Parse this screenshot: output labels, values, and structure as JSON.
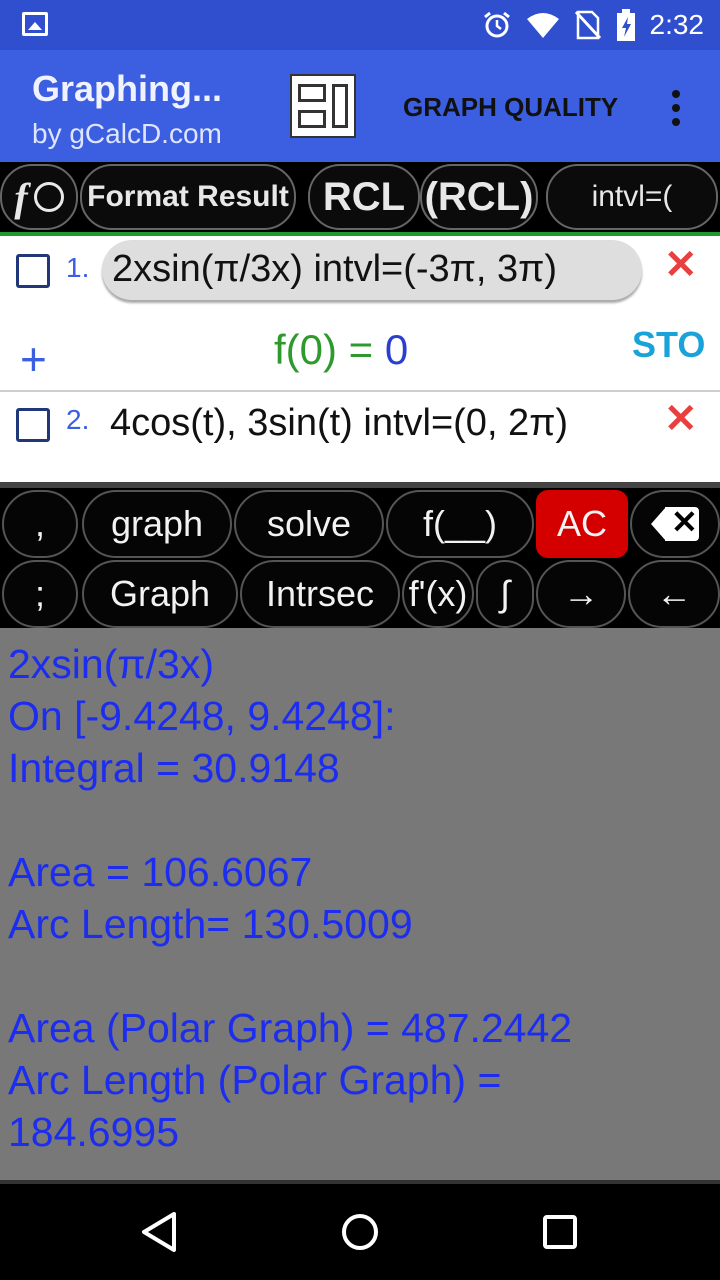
{
  "status_bar": {
    "time": "2:32",
    "icons": [
      "image-icon",
      "alarm-icon",
      "wifi-icon",
      "no-sim-icon",
      "battery-charging-icon"
    ]
  },
  "app_bar": {
    "title": "Graphing...",
    "subtitle": "by gCalcD.com",
    "graph_quality_label": "GRAPH QUALITY"
  },
  "function_toolbar": {
    "f_label": "f",
    "format_result_label": "Format Result",
    "rcl_label": "RCL",
    "paren_rcl_label": "(RCL)",
    "intvl_label": "intvl=("
  },
  "functions": [
    {
      "number": "1.",
      "expression": "2xsin(π/3x)   intvl=(-3π, 3π)"
    },
    {
      "number": "2.",
      "expression": "4cos(t), 3sin(t) intvl=(0, 2π)"
    }
  ],
  "evaluation": {
    "prefix": "f(0) = ",
    "value": "0",
    "sto_label": "STO"
  },
  "keypad": {
    "row1": [
      ",",
      "graph",
      "solve",
      "f(__)",
      "AC"
    ],
    "row2": [
      ";",
      "Graph",
      "Intrsec",
      "f'(x)",
      "∫",
      "→",
      "←"
    ]
  },
  "results": {
    "lines": [
      "2xsin(π/3x)",
      "On [-9.4248, 9.4248]:",
      "Integral = 30.9148",
      "",
      "Area = 106.6067",
      "Arc Length= 130.5009",
      "",
      "Area (Polar Graph) = 487.2442",
      "Arc Length (Polar Graph) =",
      "184.6995"
    ]
  },
  "colors": {
    "status_bar": "#2f4fcf",
    "app_bar": "#3b5fe0",
    "results_bg": "#787878",
    "results_text": "#1d2df0",
    "ac_key": "#d40000",
    "delete_x": "#e84040",
    "sto": "#1aa3d8",
    "eval_green": "#2e9a2e"
  }
}
